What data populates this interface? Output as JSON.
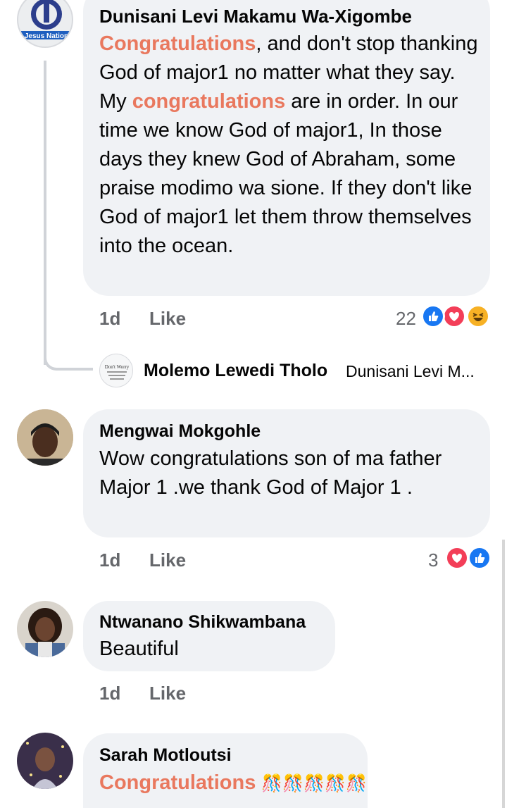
{
  "comments": [
    {
      "author": "Dunisani Levi Makamu Wa-Xigombe",
      "avatar_logo_text": "Jesus Nation",
      "text": {
        "hl1": "Congratulations",
        "t1": ", and don't stop thanking God of major1 no matter what they say. My ",
        "hl2": "congratulations",
        "t2": " are in order. In our time we know God of major1, In those days they knew God of Abraham, some praise modimo wa sione. If they don't like God of major1 let them throw themselves into the ocean."
      },
      "time": "1d",
      "like": "Like",
      "reaction_count": "22",
      "reactions": [
        "like",
        "love",
        "haha"
      ]
    },
    {
      "author": "Mengwai Mokgohle",
      "text": "Wow congratulations son of ma father Major 1 .we thank God of Major 1 .",
      "time": "1d",
      "like": "Like",
      "reaction_count": "3",
      "reactions": [
        "love",
        "like"
      ]
    },
    {
      "author": "Ntwanano Shikwambana",
      "text": "Beautiful",
      "time": "1d",
      "like": "Like"
    },
    {
      "author": "Sarah Motloutsi",
      "text": "Congratulations",
      "emoji": "🎊🎊🎊🎊🎊"
    }
  ],
  "reply": {
    "author": "Molemo Lewedi Tholo",
    "preview": "Dunisani Levi M...",
    "avatar_text": "Don't Worry"
  },
  "colors": {
    "like_blue": "#1877f2",
    "love_red": "#f33e58",
    "haha_yellow": "#f7b125",
    "highlight": "#e9785e",
    "bubble": "#f0f2f5"
  }
}
